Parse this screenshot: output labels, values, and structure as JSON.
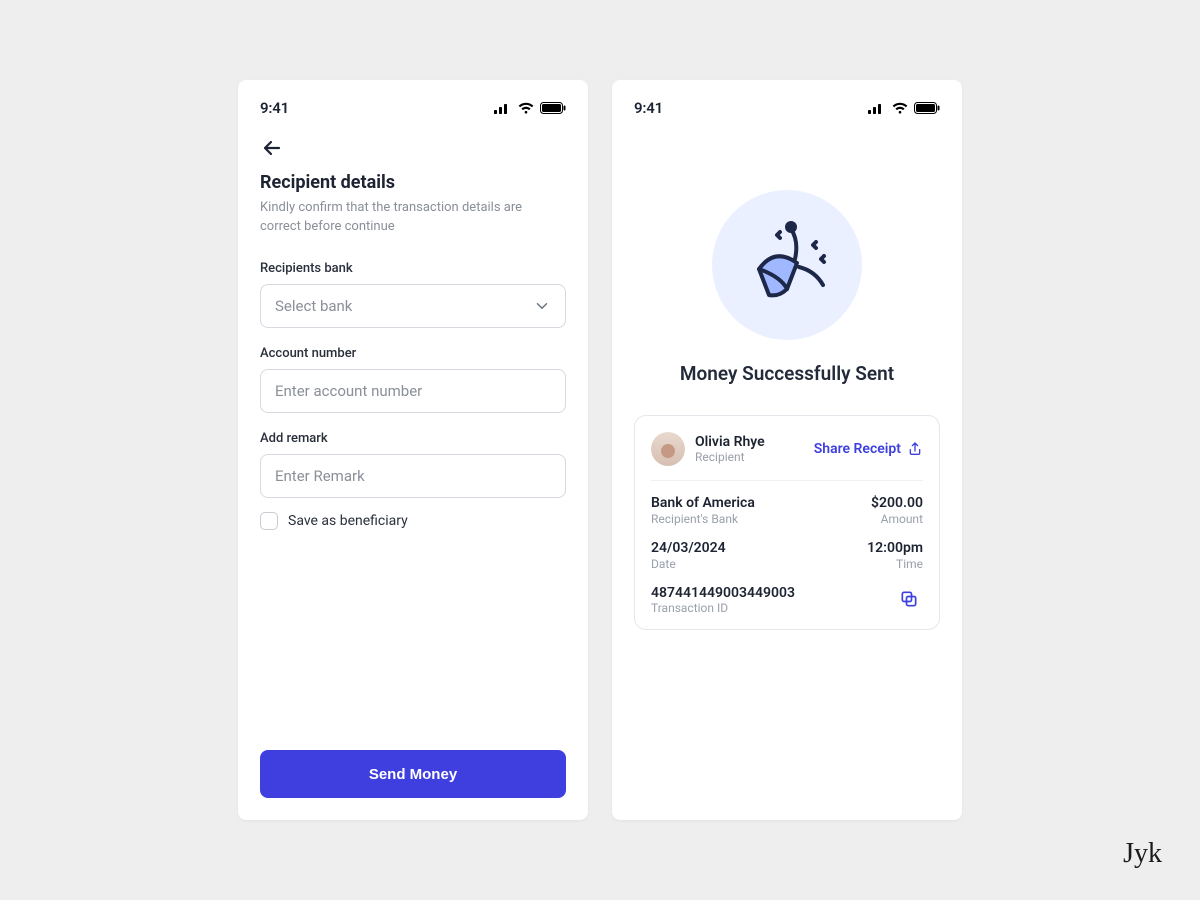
{
  "status_bar": {
    "time": "9:41"
  },
  "screen1": {
    "title": "Recipient details",
    "subtitle": "Kindly confirm that the transaction details are correct before continue",
    "bank_label": "Recipients bank",
    "bank_select_placeholder": "Select bank",
    "account_label": "Account number",
    "account_placeholder": "Enter account number",
    "remark_label": "Add remark",
    "remark_placeholder": "Enter Remark",
    "save_beneficiary_label": "Save as beneficiary",
    "submit_label": "Send Money"
  },
  "screen2": {
    "hero_title": "Money Successfully Sent",
    "recipient_name": "Olivia Rhye",
    "recipient_role": "Recipient",
    "share_label": "Share Receipt",
    "bank_value": "Bank of America",
    "bank_key": "Recipient's Bank",
    "amount_value": "$200.00",
    "amount_key": "Amount",
    "date_value": "24/03/2024",
    "date_key": "Date",
    "time_value": "12:00pm",
    "time_key": "Time",
    "txn_value": "487441449003449003",
    "txn_key": "Transaction ID"
  },
  "signature": "Jyk"
}
